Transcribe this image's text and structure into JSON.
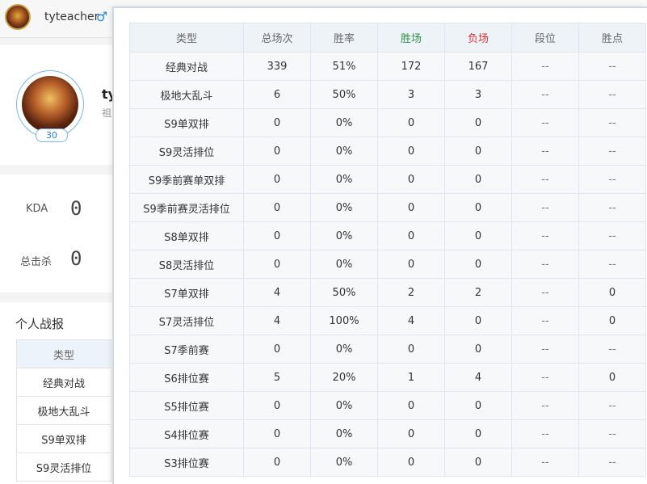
{
  "header": {
    "username": "tyteacher",
    "gender_symbol": "♂"
  },
  "profile": {
    "level": "30",
    "name_fragment": "ty",
    "sub_fragment": "祖"
  },
  "stats": {
    "kda_label": "KDA",
    "kda_value": "0",
    "kills_label": "总击杀",
    "kills_value": "0"
  },
  "personal_report": {
    "title": "个人战报",
    "column_header": "类型",
    "rows": [
      "经典对战",
      "极地大乱斗",
      "S9单双排",
      "S9灵活排位"
    ]
  },
  "popup_table": {
    "headers": [
      "类型",
      "总场次",
      "胜率",
      "胜场",
      "负场",
      "段位",
      "胜点"
    ],
    "rows": [
      [
        "经典对战",
        "339",
        "51%",
        "172",
        "167",
        "--",
        "--"
      ],
      [
        "极地大乱斗",
        "6",
        "50%",
        "3",
        "3",
        "--",
        "--"
      ],
      [
        "S9单双排",
        "0",
        "0%",
        "0",
        "0",
        "--",
        "--"
      ],
      [
        "S9灵活排位",
        "0",
        "0%",
        "0",
        "0",
        "--",
        "--"
      ],
      [
        "S9季前赛单双排",
        "0",
        "0%",
        "0",
        "0",
        "--",
        "--"
      ],
      [
        "S9季前赛灵活排位",
        "0",
        "0%",
        "0",
        "0",
        "--",
        "--"
      ],
      [
        "S8单双排",
        "0",
        "0%",
        "0",
        "0",
        "--",
        "--"
      ],
      [
        "S8灵活排位",
        "0",
        "0%",
        "0",
        "0",
        "--",
        "--"
      ],
      [
        "S7单双排",
        "4",
        "50%",
        "2",
        "2",
        "--",
        "0"
      ],
      [
        "S7灵活排位",
        "4",
        "100%",
        "4",
        "0",
        "--",
        "0"
      ],
      [
        "S7季前赛",
        "0",
        "0%",
        "0",
        "0",
        "--",
        "--"
      ],
      [
        "S6排位赛",
        "5",
        "20%",
        "1",
        "4",
        "--",
        "0"
      ],
      [
        "S5排位赛",
        "0",
        "0%",
        "0",
        "0",
        "--",
        "--"
      ],
      [
        "S4排位赛",
        "0",
        "0%",
        "0",
        "0",
        "--",
        "--"
      ],
      [
        "S3排位赛",
        "0",
        "0%",
        "0",
        "0",
        "--",
        "--"
      ]
    ]
  },
  "colors": {
    "win_header": "#2f8f4a",
    "loss_header": "#d9343a",
    "accent": "#2a7bc4"
  }
}
